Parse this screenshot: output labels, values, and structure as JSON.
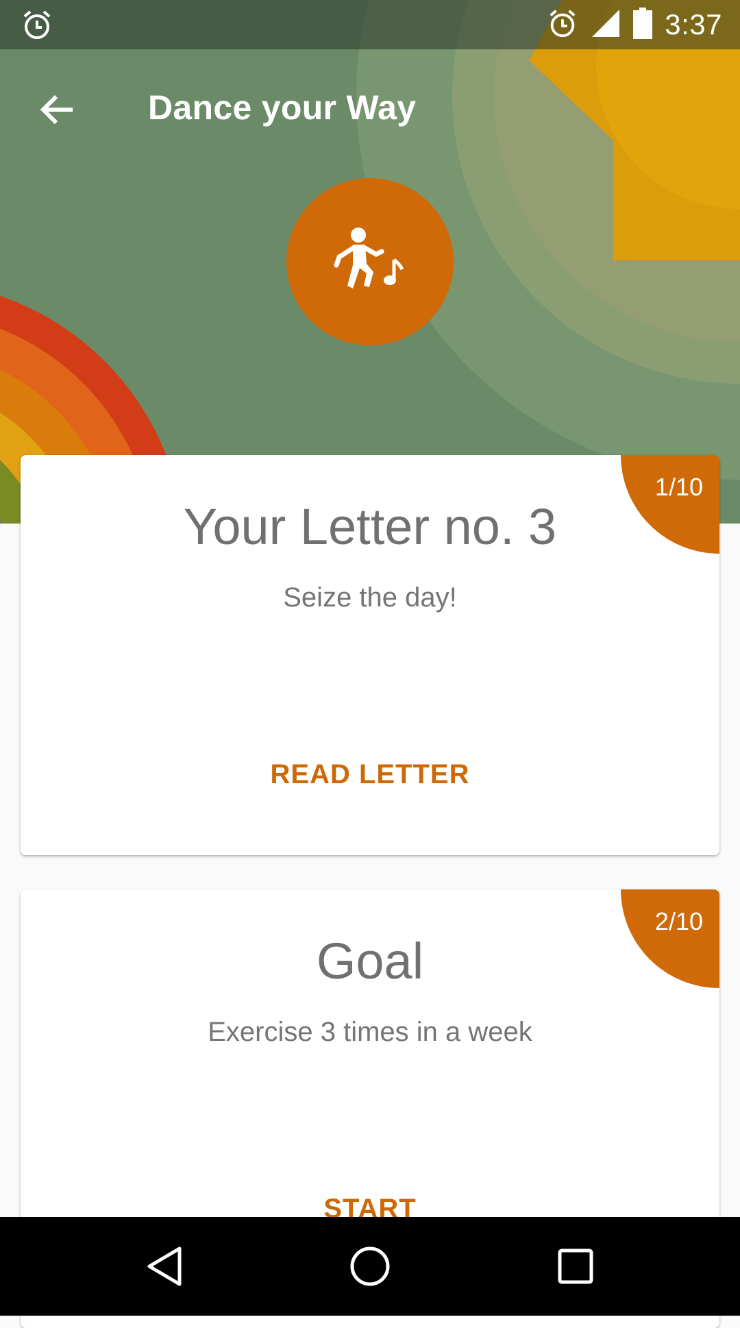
{
  "status_bar": {
    "time": "3:37",
    "left_icon": "alarm-clock-icon",
    "right_icons": [
      "alarm-clock-icon",
      "signal-icon",
      "battery-icon"
    ]
  },
  "app_bar": {
    "title": "Dance your Way",
    "back_icon": "arrow-back-icon"
  },
  "hero": {
    "icon": "dancer-music-icon",
    "badge_color": "#d06a08",
    "background_color": "#6b8b68"
  },
  "cards": [
    {
      "counter": "1/10",
      "title": "Your Letter no. 3",
      "subtitle": "Seize the day!",
      "action": "READ LETTER"
    },
    {
      "counter": "2/10",
      "title": "Goal",
      "subtitle": "Exercise 3 times in a week",
      "action": "START"
    }
  ],
  "nav_bar": {
    "back": "nav-back-icon",
    "home": "nav-home-icon",
    "recents": "nav-recents-icon"
  },
  "colors": {
    "accent": "#d06a08",
    "text_secondary": "#757575"
  }
}
